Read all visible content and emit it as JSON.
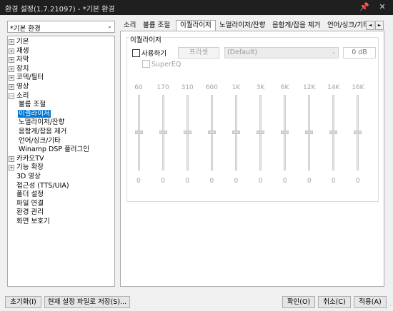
{
  "window": {
    "title": "환경 설정(1.7.21097) - *기본 환경",
    "pin_glyph": "📌",
    "close_glyph": "✕"
  },
  "preset_selector": {
    "value": "*기본 환경",
    "arrow": "⌄"
  },
  "tree": [
    {
      "label": "기본",
      "expander": "+"
    },
    {
      "label": "재생",
      "expander": "+"
    },
    {
      "label": "자막",
      "expander": "+"
    },
    {
      "label": "장치",
      "expander": "+"
    },
    {
      "label": "코덱/필터",
      "expander": "+"
    },
    {
      "label": "영상",
      "expander": "+"
    },
    {
      "label": "소리",
      "expander": "−"
    },
    {
      "label": "볼륨 조절",
      "expander": ""
    },
    {
      "label": "이퀄라이저",
      "expander": "",
      "selected": true
    },
    {
      "label": "노멀라이저/잔향",
      "expander": ""
    },
    {
      "label": "음함게/잡음 제거",
      "expander": ""
    },
    {
      "label": "언어/싱크/기타",
      "expander": ""
    },
    {
      "label": "Winamp DSP 플러그인",
      "expander": ""
    },
    {
      "label": "카카오TV",
      "expander": "+"
    },
    {
      "label": "기능 확장",
      "expander": "+"
    },
    {
      "label": "3D 영상",
      "expander": ""
    },
    {
      "label": "접근성 (TTS/UIA)",
      "expander": ""
    },
    {
      "label": "폴더 설정",
      "expander": ""
    },
    {
      "label": "파일 연결",
      "expander": ""
    },
    {
      "label": "환경 관리",
      "expander": ""
    },
    {
      "label": "화면 보호기",
      "expander": ""
    }
  ],
  "tabs": [
    {
      "label": "소리"
    },
    {
      "label": "볼륨 조절"
    },
    {
      "label": "이퀄라이저",
      "active": true
    },
    {
      "label": "노멀라이저/잔향"
    },
    {
      "label": "음함게/잡음 제거"
    },
    {
      "label": "언어/싱크/기타"
    }
  ],
  "tab_scroll": {
    "left": "◄",
    "right": "►"
  },
  "equalizer": {
    "group_title": "이퀄라이저",
    "enable_label": "사용하기",
    "enabled": false,
    "preset_button": "프리셋",
    "preset_value": "(Default)",
    "preset_arrow": "⌄",
    "preamp": "0 dB",
    "supereq_label": "SuperEQ",
    "bands": [
      {
        "freq": "60",
        "value": "0"
      },
      {
        "freq": "170",
        "value": "0"
      },
      {
        "freq": "310",
        "value": "0"
      },
      {
        "freq": "600",
        "value": "0"
      },
      {
        "freq": "1K",
        "value": "0"
      },
      {
        "freq": "3K",
        "value": "0"
      },
      {
        "freq": "6K",
        "value": "0"
      },
      {
        "freq": "12K",
        "value": "0"
      },
      {
        "freq": "14K",
        "value": "0"
      },
      {
        "freq": "16K",
        "value": "0"
      }
    ]
  },
  "buttons": {
    "reset": "초기화(I)",
    "save_current": "현재 설정 파일로 저장(S)...",
    "ok": "확인(O)",
    "cancel": "취소(C)",
    "apply": "적용(A)"
  },
  "resize_grip": "⋰"
}
